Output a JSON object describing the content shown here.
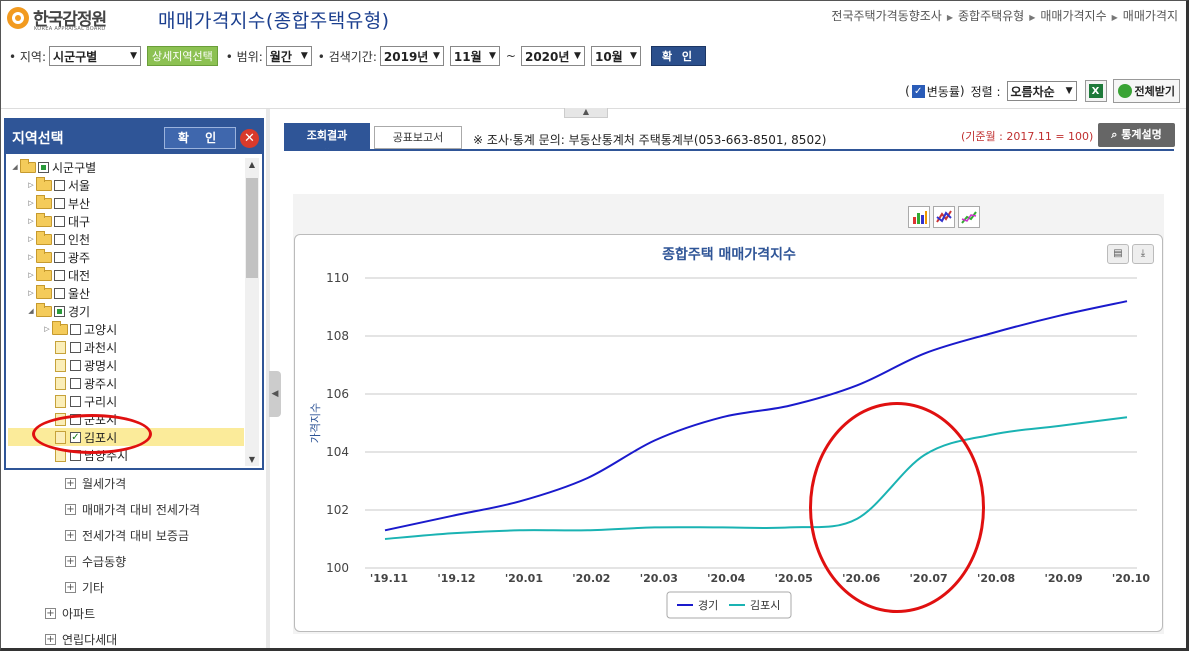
{
  "header": {
    "logo_name": "한국감정원",
    "logo_sub": "KOREA APPRAISAL BOARD",
    "page_title": "매매가격지수(종합주택유형)",
    "breadcrumb": [
      "전국주택가격동향조사",
      "종합주택유형",
      "매매가격지수",
      "매매가격지"
    ]
  },
  "filter": {
    "region_label": "• 지역:",
    "region_value": "시군구별",
    "detail_button": "상세지역선택",
    "scope_label": "• 범위:",
    "scope_value": "월간",
    "period_label": "• 검색기간:",
    "start_year": "2019년",
    "start_month": "11월",
    "tilde": "~",
    "end_year": "2020년",
    "end_month": "10월",
    "confirm": "확 인"
  },
  "controls": {
    "open_paren": "(",
    "rate_label": "변동률",
    "close_paren": ")",
    "sort_label": "정렬 :",
    "sort_value": "오름차순",
    "download_label": "전체받기"
  },
  "region_panel": {
    "title": "지역선택",
    "ok_button": "확 인",
    "close_icon": "✕",
    "tree": [
      {
        "label": "시군구별",
        "level": 0,
        "type": "folder",
        "expanded": true,
        "check": "partial"
      },
      {
        "label": "서울",
        "level": 1,
        "type": "folder",
        "expanded": false,
        "check": "none"
      },
      {
        "label": "부산",
        "level": 1,
        "type": "folder",
        "expanded": false,
        "check": "none"
      },
      {
        "label": "대구",
        "level": 1,
        "type": "folder",
        "expanded": false,
        "check": "none"
      },
      {
        "label": "인천",
        "level": 1,
        "type": "folder",
        "expanded": false,
        "check": "none"
      },
      {
        "label": "광주",
        "level": 1,
        "type": "folder",
        "expanded": false,
        "check": "none"
      },
      {
        "label": "대전",
        "level": 1,
        "type": "folder",
        "expanded": false,
        "check": "none"
      },
      {
        "label": "울산",
        "level": 1,
        "type": "folder",
        "expanded": false,
        "check": "none"
      },
      {
        "label": "경기",
        "level": 1,
        "type": "folder",
        "expanded": true,
        "check": "partial"
      },
      {
        "label": "고양시",
        "level": 2,
        "type": "folder",
        "expanded": false,
        "check": "none"
      },
      {
        "label": "과천시",
        "level": 2,
        "type": "doc",
        "check": "none"
      },
      {
        "label": "광명시",
        "level": 2,
        "type": "doc",
        "check": "none"
      },
      {
        "label": "광주시",
        "level": 2,
        "type": "doc",
        "check": "none"
      },
      {
        "label": "구리시",
        "level": 2,
        "type": "doc",
        "check": "none"
      },
      {
        "label": "군포시",
        "level": 2,
        "type": "doc",
        "check": "none"
      },
      {
        "label": "김포시",
        "level": 2,
        "type": "doc",
        "check": "checked",
        "selected": true
      },
      {
        "label": "남양주시",
        "level": 2,
        "type": "doc",
        "check": "none"
      }
    ]
  },
  "menu": [
    {
      "label": "월세가격",
      "indent": 1
    },
    {
      "label": "매매가격 대비 전세가격",
      "indent": 1
    },
    {
      "label": "전세가격 대비 보증금",
      "indent": 1
    },
    {
      "label": "수급동향",
      "indent": 1
    },
    {
      "label": "기타",
      "indent": 1
    },
    {
      "label": "아파트",
      "indent": 0
    },
    {
      "label": "연립다세대",
      "indent": 0
    }
  ],
  "tabs": {
    "result": "조회결과",
    "report": "공표보고서"
  },
  "inquiry": "※ 조사·통계 문의: 부동산통계처 주택통계부(053-663-8501, 8502)",
  "base_month": "(기준월 : 2017.11 = 100)",
  "stat_button": "통계설명",
  "colors": {
    "navy": "#2f5597",
    "series_gyeonggi": "#1a1acc",
    "series_gimpo": "#1ab3b3",
    "annotation": "#e01010"
  },
  "chart_data": {
    "type": "line",
    "title": "종합주택 매매가격지수",
    "xlabel": "",
    "ylabel": "가격지수",
    "categories": [
      "'19.11",
      "'19.12",
      "'20.01",
      "'20.02",
      "'20.03",
      "'20.04",
      "'20.05",
      "'20.06",
      "'20.07",
      "'20.08",
      "'20.09",
      "'20.10"
    ],
    "ylim": [
      100,
      110
    ],
    "yticks": [
      100,
      102,
      104,
      106,
      108,
      110
    ],
    "grid": true,
    "legend": "bottom-center",
    "series": [
      {
        "name": "경기",
        "color": "#1a1acc",
        "values": [
          101.3,
          101.8,
          102.3,
          103.1,
          104.4,
          105.2,
          105.6,
          106.3,
          107.4,
          108.1,
          108.7,
          109.2
        ]
      },
      {
        "name": "김포시",
        "color": "#1ab3b3",
        "values": [
          101.0,
          101.2,
          101.3,
          101.3,
          101.4,
          101.4,
          101.4,
          101.7,
          103.9,
          104.6,
          104.9,
          105.2
        ]
      }
    ]
  }
}
